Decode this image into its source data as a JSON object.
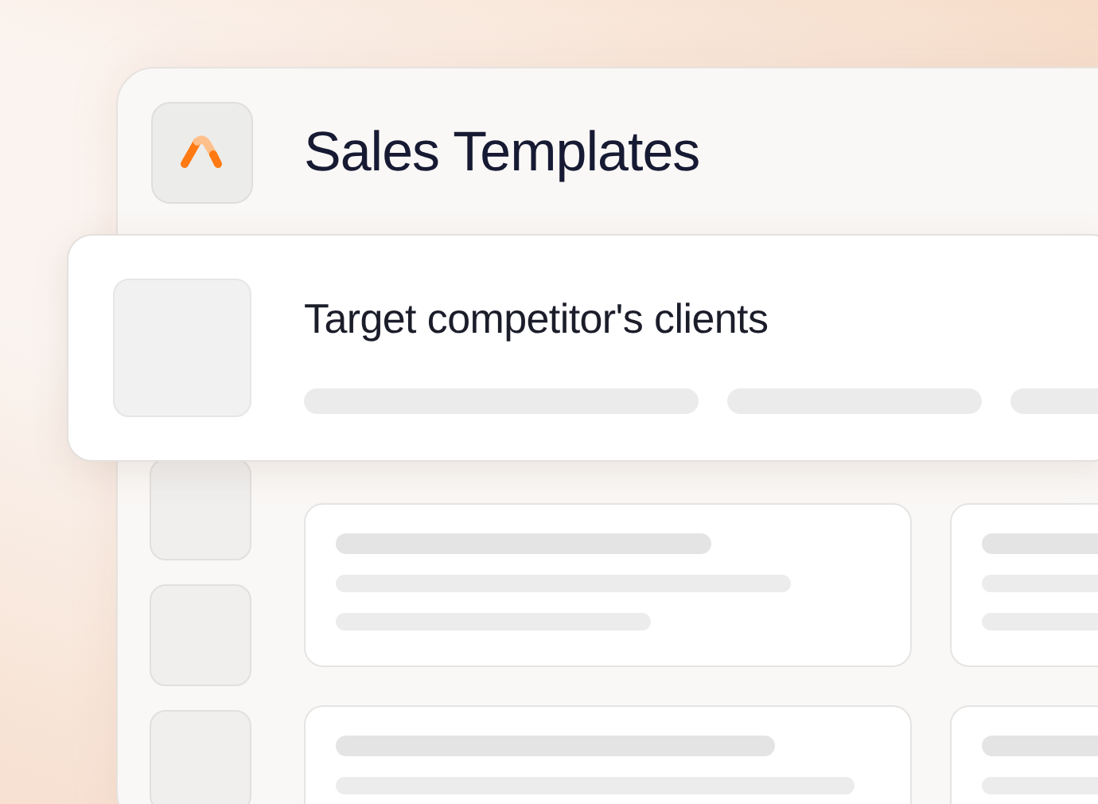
{
  "window": {
    "title": "Sales Templates"
  },
  "highlighted_template": {
    "title": "Target competitor's clients"
  }
}
